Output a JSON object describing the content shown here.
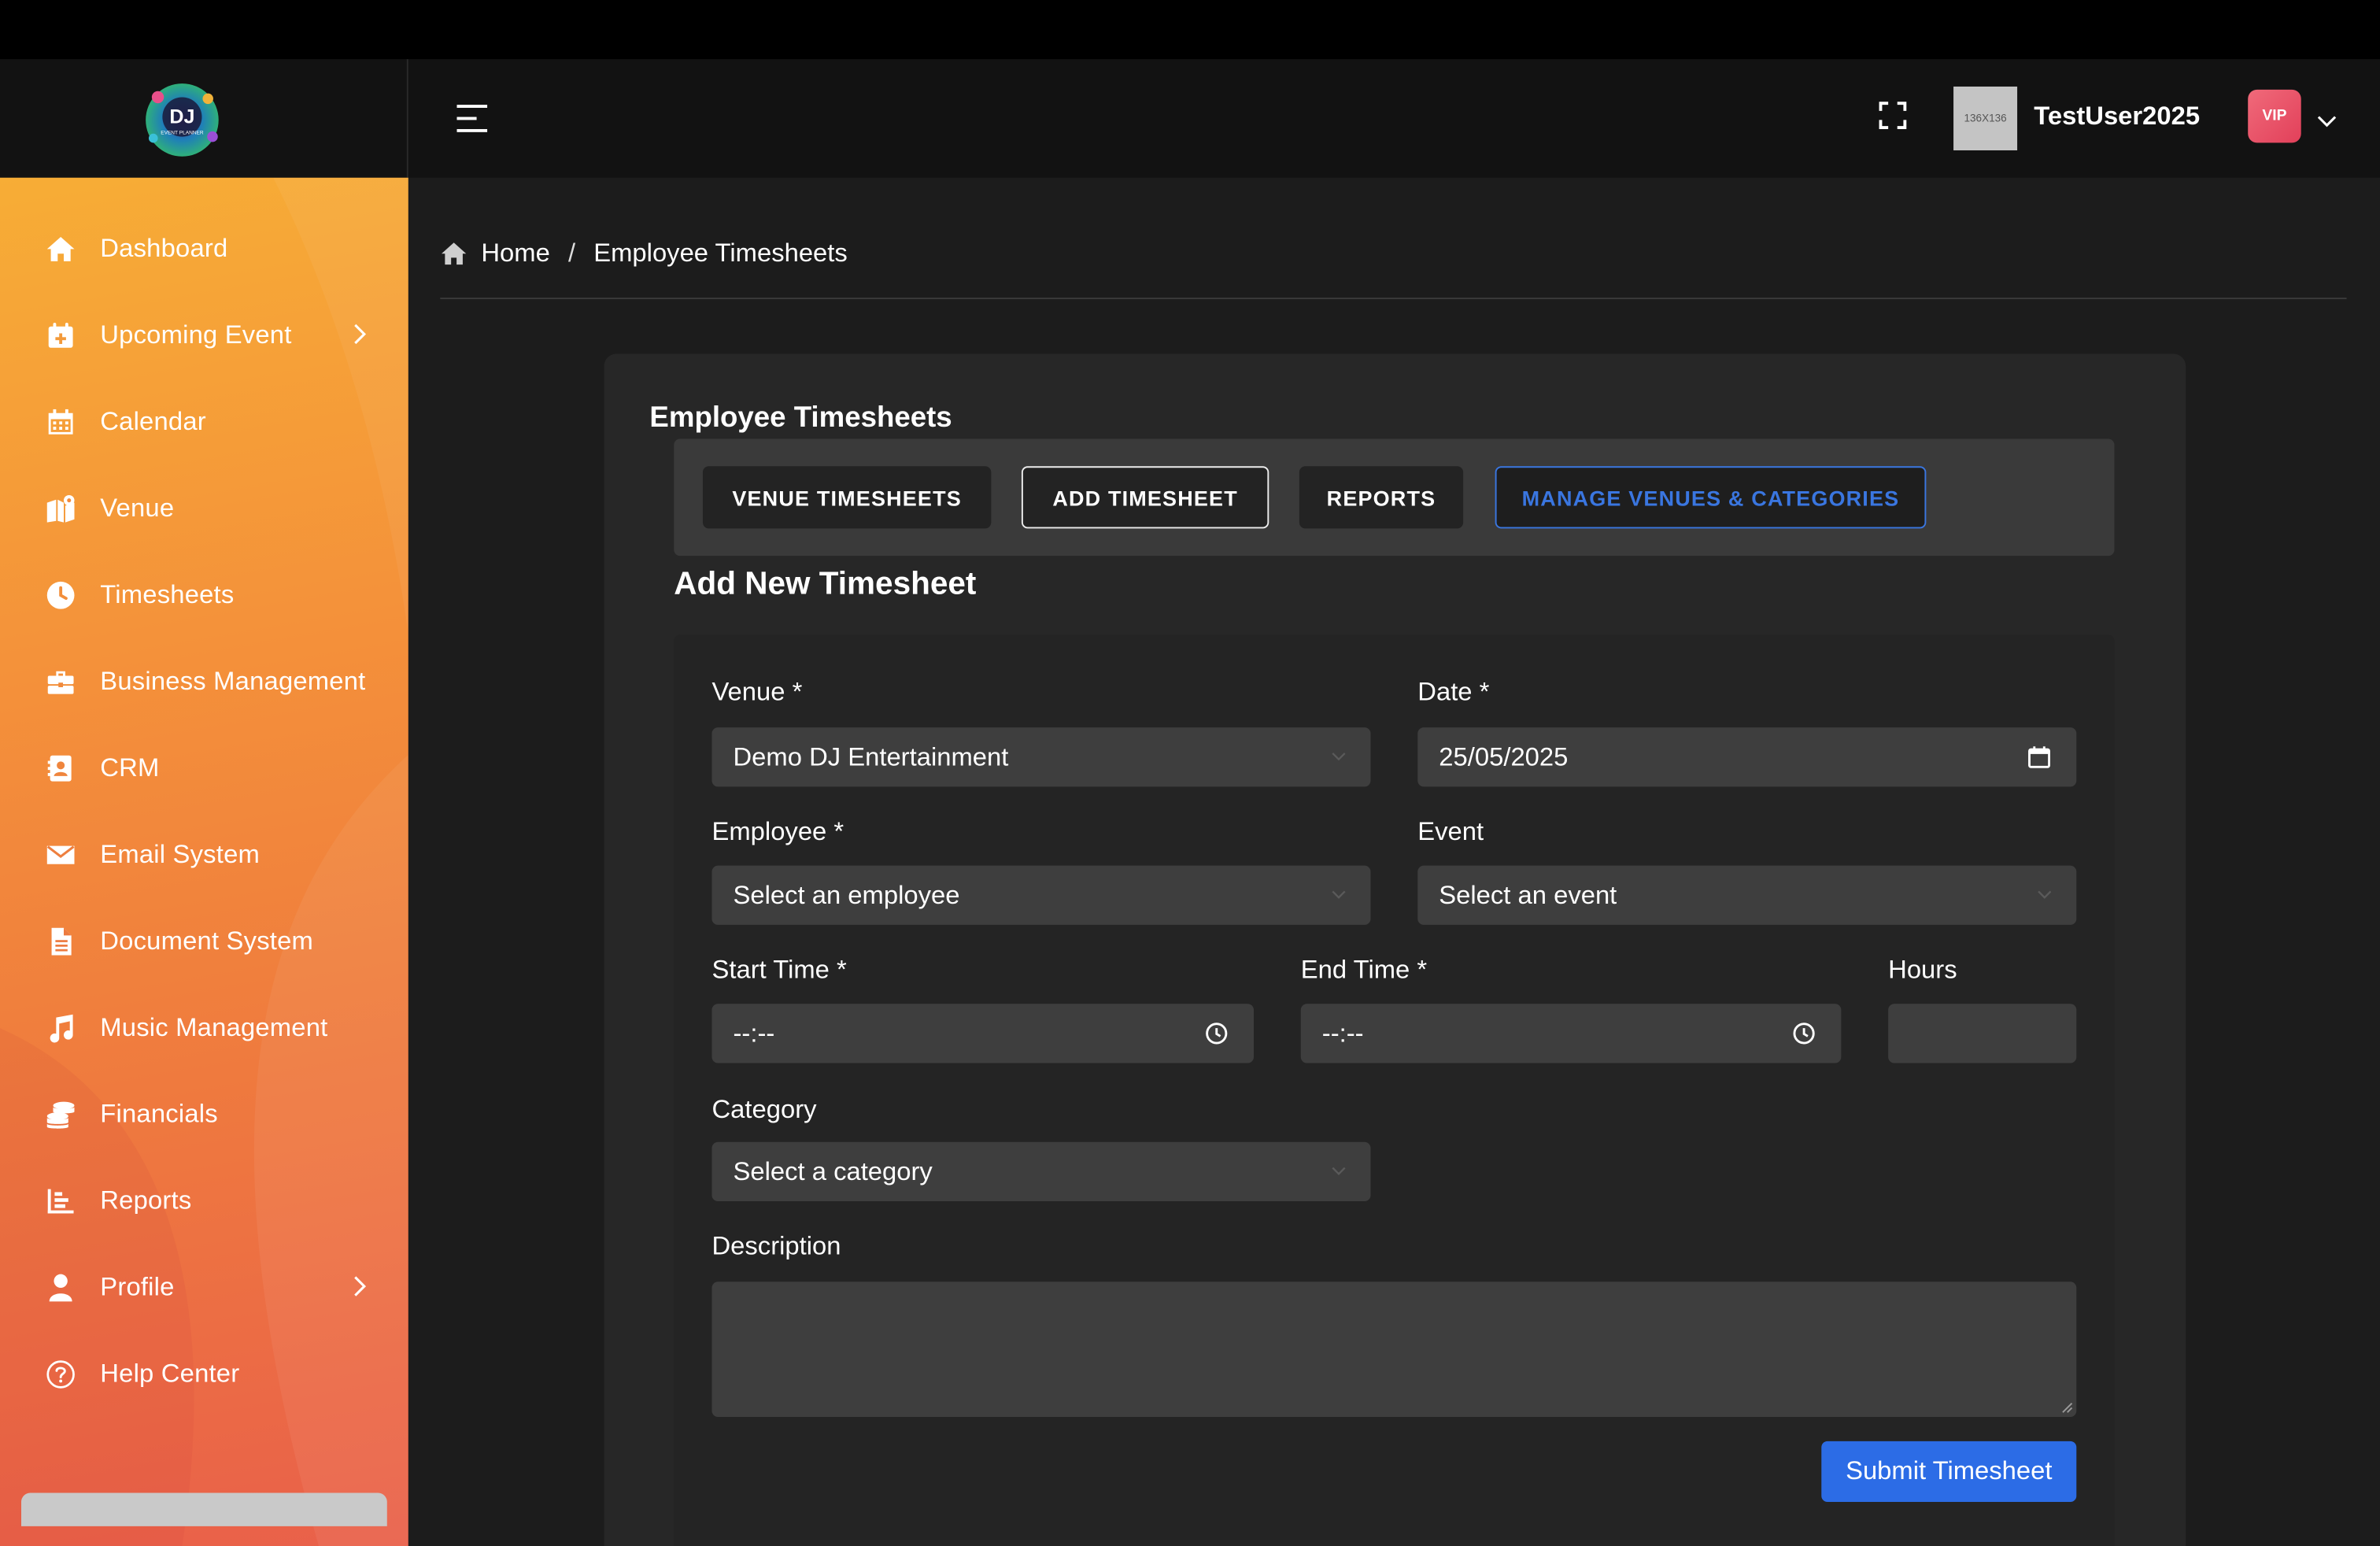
{
  "app": {
    "logo_name": "DJ Event Planner",
    "logo_text": "DJ",
    "logo_subtext": "EVENT PLANNER"
  },
  "header": {
    "avatar_text": "136X136",
    "username": "TestUser2025",
    "badge": "VIP"
  },
  "sidebar": {
    "items": [
      {
        "label": "Dashboard",
        "icon": "home-icon",
        "has_submenu": false
      },
      {
        "label": "Upcoming Event",
        "icon": "calendar-plus-icon",
        "has_submenu": true
      },
      {
        "label": "Calendar",
        "icon": "calendar-icon",
        "has_submenu": false
      },
      {
        "label": "Venue",
        "icon": "map-location-icon",
        "has_submenu": false
      },
      {
        "label": "Timesheets",
        "icon": "clock-icon",
        "has_submenu": false
      },
      {
        "label": "Business Management",
        "icon": "briefcase-icon",
        "has_submenu": false
      },
      {
        "label": "CRM",
        "icon": "contact-card-icon",
        "has_submenu": false
      },
      {
        "label": "Email System",
        "icon": "envelope-icon",
        "has_submenu": false
      },
      {
        "label": "Document System",
        "icon": "document-icon",
        "has_submenu": false
      },
      {
        "label": "Music Management",
        "icon": "music-note-icon",
        "has_submenu": false
      },
      {
        "label": "Financials",
        "icon": "coins-icon",
        "has_submenu": false
      },
      {
        "label": "Reports",
        "icon": "bar-chart-icon",
        "has_submenu": false
      },
      {
        "label": "Profile",
        "icon": "user-icon",
        "has_submenu": true
      },
      {
        "label": "Help Center",
        "icon": "question-circle-icon",
        "has_submenu": false
      }
    ]
  },
  "breadcrumb": {
    "home": "Home",
    "separator": "/",
    "current": "Employee Timesheets"
  },
  "card": {
    "title": "Employee Timesheets",
    "tabs": {
      "venue_timesheets": "VENUE TIMESHEETS",
      "add_timesheet": "ADD TIMESHEET",
      "reports": "REPORTS",
      "manage_venues": "MANAGE VENUES & CATEGORIES"
    },
    "section_title": "Add New Timesheet"
  },
  "form": {
    "venue_label": "Venue *",
    "venue_value": "Demo DJ Entertainment",
    "date_label": "Date *",
    "date_value": "25/05/2025",
    "employee_label": "Employee *",
    "employee_value": "Select an employee",
    "event_label": "Event",
    "event_value": "Select an event",
    "start_time_label": "Start Time *",
    "start_time_value": "--:--",
    "end_time_label": "End Time *",
    "end_time_value": "--:--",
    "hours_label": "Hours",
    "hours_value": "",
    "category_label": "Category",
    "category_value": "Select a category",
    "description_label": "Description",
    "description_value": "",
    "submit_label": "Submit Timesheet"
  },
  "colors": {
    "sidebar_gradient_start": "#f7ad36",
    "sidebar_gradient_end": "#e9604a",
    "primary_blue": "#2c6ce6",
    "manage_tab_blue": "#3a76e0",
    "vip_badge": "#e2405a",
    "card_bg": "#272727",
    "field_bg": "#3e3e3e"
  }
}
